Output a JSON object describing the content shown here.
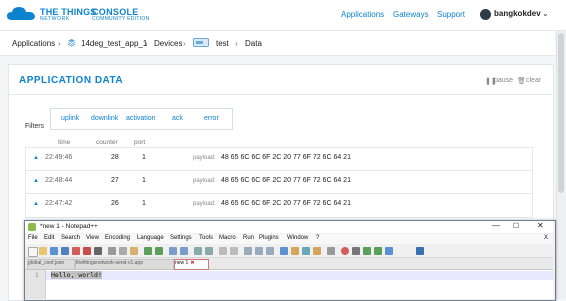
{
  "brand": {
    "name_line1": "THE THINGS",
    "name_line1b": "NETWORK",
    "name_line2": "CONSOLE",
    "name_line2b": "COMMUNITY EDITION"
  },
  "nav": {
    "applications": "Applications",
    "gateways": "Gateways",
    "support": "Support",
    "username": "bangkokdev"
  },
  "breadcrumb": {
    "applications": "Applications",
    "app": "14deg_test_app_1",
    "devices": "Devices",
    "device": "test",
    "data": "Data"
  },
  "card": {
    "title": "APPLICATION DATA",
    "pause": "pause",
    "clear": "clear"
  },
  "filters": {
    "label": "Filters",
    "tabs": [
      "uplink",
      "downlink",
      "activation",
      "ack",
      "error"
    ]
  },
  "table": {
    "headers": {
      "time": "time",
      "counter": "counter",
      "port": "port"
    },
    "rows": [
      {
        "time": "22:49:46",
        "counter": "28",
        "port": "1",
        "payload_label": "payload:",
        "payload": "48 65 6C 6C 6F 2C 20 77 6F 72 6C 64 21"
      },
      {
        "time": "22:48:44",
        "counter": "27",
        "port": "1",
        "payload_label": "payload:",
        "payload": "48 65 6C 6C 6F 2C 20 77 6F 72 6C 64 21"
      },
      {
        "time": "22:47:42",
        "counter": "26",
        "port": "1",
        "payload_label": "payload:",
        "payload": "48 65 6C 6C 6F 2C 20 77 6F 72 6C 64 21"
      }
    ]
  },
  "notepad": {
    "title": "*new 1 - Notepad++",
    "menu": [
      "File",
      "Edit",
      "Search",
      "View",
      "Encoding",
      "Language",
      "Settings",
      "Tools",
      "Macro",
      "Run",
      "Plugins",
      "Window",
      "?"
    ],
    "close_x": "X",
    "tabs": [
      {
        "label": "global_conf.json"
      },
      {
        "label": "thethingsnetwork-send-v1.app"
      },
      {
        "label": "new 1"
      }
    ],
    "line_number": "1",
    "code": "Hello, world!"
  }
}
